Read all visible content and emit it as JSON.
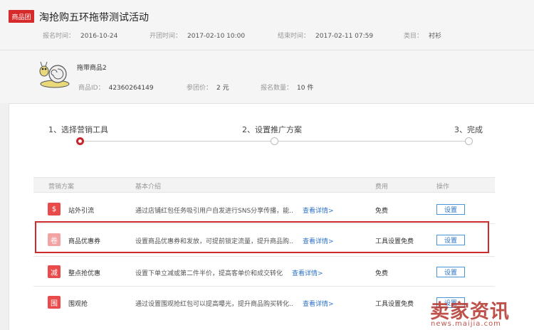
{
  "header": {
    "badge": "商品团",
    "title": "淘抢购五环拖带测试活动",
    "apply_time_label": "报名时间：",
    "apply_time": "2016-10-24",
    "start_time_label": "开团时间：",
    "start_time": "2017-02-10 10:00",
    "end_time_label": "结束时间：",
    "end_time": "2017-02-11 07:59",
    "category_label": "类目：",
    "category": "衬衫"
  },
  "product": {
    "name": "拖带商品2",
    "id_label": "商品ID：",
    "id": "42360264149",
    "price_label": "参团价：",
    "price": "2 元",
    "qty_label": "报名数量：",
    "qty": "10 件"
  },
  "steps": [
    {
      "label": "1、选择营销工具"
    },
    {
      "label": "2、设置推广方案"
    },
    {
      "label": "3、完成"
    }
  ],
  "table": {
    "headers": [
      "营销方案",
      "基本介绍",
      "费用",
      "操作"
    ],
    "rows": [
      {
        "icon_char": "$",
        "icon_name": "money-bag-icon",
        "name": "站外引流",
        "desc": "通过店铺红包任务吸引用户自发进行SNS分享传播，能..",
        "link": "查看详情>",
        "fee": "免费",
        "action": "设置"
      },
      {
        "icon_char": "卷",
        "icon_name": "coupon-icon",
        "name": "商品优惠券",
        "desc": "设置商品优惠券和发放，可提前锁定流量，提升商品购..",
        "link": "查看详情>",
        "fee": "工具设置免费",
        "action": "设置"
      },
      {
        "icon_char": "减",
        "icon_name": "discount-icon",
        "name": "整点抢优惠",
        "desc": "设置下单立减或第二件半价，提高客单价和成交转化",
        "link": "查看详情>",
        "fee": "免费",
        "action": "设置"
      },
      {
        "icon_char": "围",
        "icon_name": "grab-icon",
        "name": "围观抢",
        "desc": "通过设置围观抢红包可以提高曝光，提升商品购买转化..",
        "link": "查看详情>",
        "fee": "工具设置免费",
        "action": "设置"
      }
    ]
  },
  "watermark": {
    "main": "卖家资讯",
    "sub": "news.maijia.com"
  },
  "colors": {
    "accent_red": "#d72a2a",
    "link_blue": "#2c72c7"
  }
}
